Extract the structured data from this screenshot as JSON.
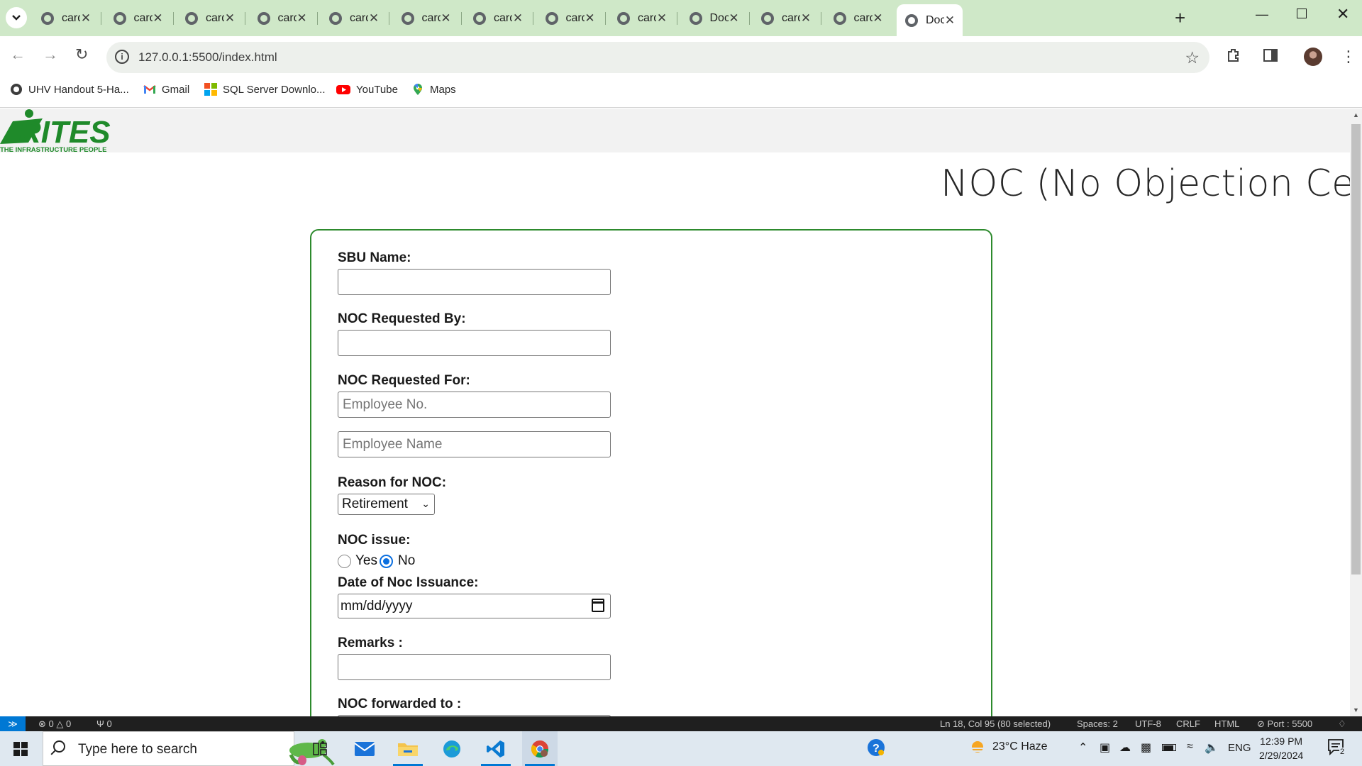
{
  "browser": {
    "tabs": [
      {
        "title": "cards"
      },
      {
        "title": "cards"
      },
      {
        "title": "cards"
      },
      {
        "title": "cards"
      },
      {
        "title": "cards"
      },
      {
        "title": "cards"
      },
      {
        "title": "cards"
      },
      {
        "title": "cards"
      },
      {
        "title": "cards"
      },
      {
        "title": "Docu"
      },
      {
        "title": "cards"
      },
      {
        "title": "cards"
      },
      {
        "title": "Docu"
      }
    ],
    "active_tab_index": 12,
    "url": "127.0.0.1:5500/index.html",
    "bookmarks": [
      {
        "label": "UHV Handout 5-Ha...",
        "icon": "globe-icon"
      },
      {
        "label": "Gmail",
        "icon": "gmail-icon"
      },
      {
        "label": "SQL Server Downlo...",
        "icon": "microsoft-icon"
      },
      {
        "label": "YouTube",
        "icon": "youtube-icon"
      },
      {
        "label": "Maps",
        "icon": "maps-icon"
      }
    ]
  },
  "page": {
    "logo": {
      "wordmark": "RITES",
      "tagline": "THE INFRASTRUCTURE PEOPLE"
    },
    "title": "NOC (No Objection Certifi",
    "form": {
      "sbu_label": "SBU Name:",
      "requested_by_label": "NOC Requested By:",
      "requested_for_label": "NOC Requested For:",
      "employee_no_placeholder": "Employee No.",
      "employee_name_placeholder": "Employee Name",
      "reason_label": "Reason for NOC:",
      "reason_selected": "Retirement",
      "issue_label": "NOC issue:",
      "issue_yes": "Yes",
      "issue_no": "No",
      "issue_selected": "No",
      "date_label": "Date of Noc Issuance:",
      "date_placeholder": "mm/dd/yyyy",
      "remarks_label": "Remarks :",
      "forwarded_label": "NOC forwarded to :"
    }
  },
  "vscode_status": {
    "errors": "0",
    "warnings": "0",
    "ports": "0",
    "cursor": "Ln 18, Col 95 (80 selected)",
    "spaces": "Spaces: 2",
    "encoding": "UTF-8",
    "eol": "CRLF",
    "language": "HTML",
    "port": "Port : 5500"
  },
  "taskbar": {
    "search_placeholder": "Type here to search",
    "weather": "23°C  Haze",
    "language": "ENG",
    "time": "12:39 PM",
    "date": "2/29/2024",
    "notifications": "2"
  },
  "colors": {
    "tab_strip": "#cfe8c8",
    "form_border": "#2d8a2d",
    "rites_green": "#1f8a2a",
    "radio_blue": "#0b6fe0",
    "statusbar": "#1f1f1f",
    "remote_blue": "#0078d4"
  }
}
